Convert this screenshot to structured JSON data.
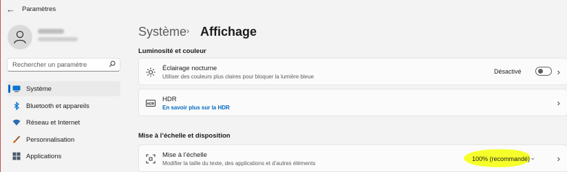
{
  "window": {
    "title": "Paramètres"
  },
  "search": {
    "placeholder": "Rechercher un paramètre"
  },
  "sidebar": {
    "items": [
      {
        "label": "Système",
        "icon": "monitor-icon",
        "active": true
      },
      {
        "label": "Bluetooth et appareils",
        "icon": "bluetooth-icon"
      },
      {
        "label": "Réseau et Internet",
        "icon": "wifi-icon"
      },
      {
        "label": "Personnalisation",
        "icon": "brush-icon"
      },
      {
        "label": "Applications",
        "icon": "apps-icon"
      }
    ]
  },
  "breadcrumb": {
    "parent": "Système",
    "separator": "›",
    "current": "Affichage"
  },
  "sections": {
    "brightness": "Luminosité et couleur",
    "scale": "Mise à l’échelle et disposition"
  },
  "cards": {
    "night_light": {
      "title": "Éclairage nocturne",
      "subtitle": "Utiliser des couleurs plus claires pour bloquer la lumière bleue",
      "toggle_label": "Désactivé",
      "toggle_on": false
    },
    "hdr": {
      "title": "HDR",
      "link": "En savoir plus sur la HDR"
    },
    "scale": {
      "title": "Mise à l’échelle",
      "subtitle": "Modifier la taille du texte, des applications et d’autres éléments",
      "value": "100% (recommandé)"
    }
  },
  "colors": {
    "accent": "#0067c0",
    "highlight": "#f6ff2a"
  }
}
